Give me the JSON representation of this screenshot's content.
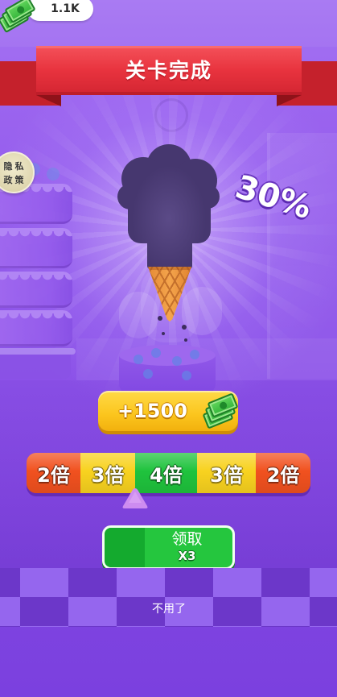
{
  "currency": {
    "amount": "1.1K",
    "icon": "cash-stack-icon"
  },
  "banner": {
    "title": "关卡完成"
  },
  "privacy_badge": {
    "line1": "隐私",
    "line2": "政策"
  },
  "progress_label": "30%",
  "reward": {
    "amount": "+1500",
    "icon": "cash-stack-icon"
  },
  "multiplier_bar": {
    "segments": [
      {
        "label": "2倍",
        "color": "#f1511f"
      },
      {
        "label": "3倍",
        "color": "#f8d21f"
      },
      {
        "label": "4倍",
        "color": "#1fc33d"
      },
      {
        "label": "3倍",
        "color": "#f8d21f"
      },
      {
        "label": "2倍",
        "color": "#f1511f"
      }
    ],
    "pointer_icon": "triangle-pointer-icon"
  },
  "claim_button": {
    "label": "领取",
    "multiplier": "X3"
  },
  "skip_button": {
    "label": "不用了"
  },
  "colors": {
    "background": "#8c52e8",
    "banner": "#e8333e",
    "reward": "#fbc51d",
    "claim": "#25c63e"
  }
}
